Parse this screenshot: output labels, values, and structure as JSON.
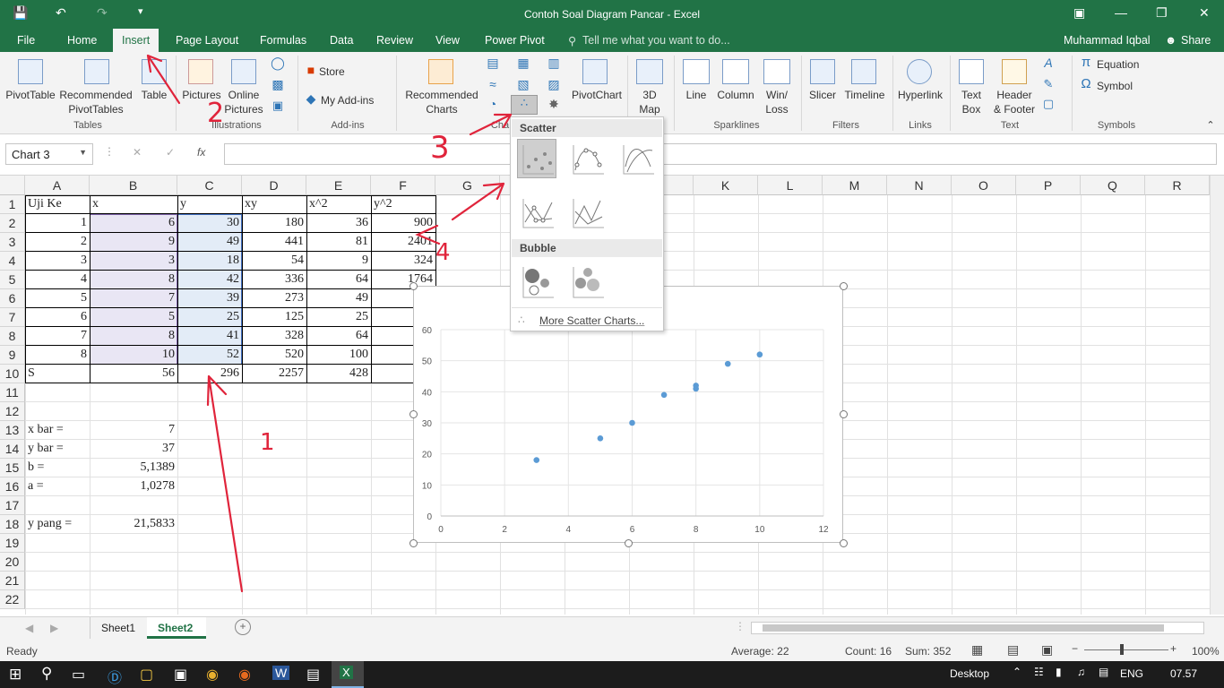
{
  "title_bar": {
    "title": "Contoh Soal Diagram Pancar - Excel"
  },
  "tabs": [
    "File",
    "Home",
    "Insert",
    "Page Layout",
    "Formulas",
    "Data",
    "Review",
    "View",
    "Power Pivot"
  ],
  "active_tab": "Insert",
  "tell_me": "Tell me what you want to do...",
  "user": "Muhammad Iqbal",
  "share": "Share",
  "ribbon": {
    "pivottable": "PivotTable",
    "recommended_pivottables_1": "Recommended",
    "recommended_pivottables_2": "PivotTables",
    "table": "Table",
    "pictures": "Pictures",
    "online_pictures_1": "Online",
    "online_pictures_2": "Pictures",
    "store": "Store",
    "my_addins": "My Add-ins",
    "recommended_charts_1": "Recommended",
    "recommended_charts_2": "Charts",
    "pivotchart": "PivotChart",
    "map_1": "3D",
    "map_2": "Map",
    "line": "Line",
    "column": "Column",
    "winloss_1": "Win/",
    "winloss_2": "Loss",
    "slicer": "Slicer",
    "timeline": "Timeline",
    "hyperlink": "Hyperlink",
    "textbox_1": "Text",
    "textbox_2": "Box",
    "header_1": "Header",
    "header_2": "& Footer",
    "equation": "Equation",
    "symbol": "Symbol",
    "groups": {
      "tables": "Tables",
      "illustrations": "Illustrations",
      "addins": "Add-ins",
      "charts": "Cha",
      "sparklines": "Sparklines",
      "filters": "Filters",
      "links": "Links",
      "text": "Text",
      "symbols": "Symbols"
    }
  },
  "formula_bar": {
    "name_box": "Chart 3",
    "fx": "fx",
    "formula": ""
  },
  "columns": [
    "A",
    "B",
    "C",
    "D",
    "E",
    "F",
    "G",
    "H",
    "I",
    "J",
    "K",
    "L",
    "M",
    "N",
    "O",
    "P",
    "Q",
    "R"
  ],
  "rows": [
    "1",
    "2",
    "3",
    "4",
    "5",
    "6",
    "7",
    "8",
    "9",
    "10",
    "11",
    "12",
    "13",
    "14",
    "15",
    "16",
    "17",
    "18",
    "19",
    "20",
    "21",
    "22"
  ],
  "cells": {
    "header": [
      "Uji Ke",
      "x",
      "y",
      "xy",
      "x^2",
      "y^2"
    ],
    "data": [
      [
        "1",
        "6",
        "30",
        "180",
        "36",
        "900"
      ],
      [
        "2",
        "9",
        "49",
        "441",
        "81",
        "2401"
      ],
      [
        "3",
        "3",
        "18",
        "54",
        "9",
        "324"
      ],
      [
        "4",
        "8",
        "42",
        "336",
        "64",
        "1764"
      ],
      [
        "5",
        "7",
        "39",
        "273",
        "49",
        "1"
      ],
      [
        "6",
        "5",
        "25",
        "125",
        "25",
        ""
      ],
      [
        "7",
        "8",
        "41",
        "328",
        "64",
        "1"
      ],
      [
        "8",
        "10",
        "52",
        "520",
        "100",
        "2"
      ]
    ],
    "sum_row": [
      "S",
      "56",
      "296",
      "2257",
      "428",
      "11"
    ],
    "calc": [
      {
        "label": "x bar =",
        "value": "7"
      },
      {
        "label": "y bar =",
        "value": "37"
      },
      {
        "label": "b =",
        "value": "5,1389"
      },
      {
        "label": "a =",
        "value": "1,0278"
      },
      {
        "label": "y pang =",
        "value": "21,5833"
      }
    ]
  },
  "dropdown": {
    "scatter": "Scatter",
    "bubble": "Bubble",
    "more": "More Scatter Charts..."
  },
  "chart_data": {
    "type": "scatter",
    "x": [
      6,
      9,
      3,
      8,
      7,
      5,
      8,
      10
    ],
    "y": [
      30,
      49,
      18,
      42,
      39,
      25,
      41,
      52
    ],
    "xlim": [
      0,
      12
    ],
    "ylim": [
      0,
      60
    ],
    "xticks": [
      "0",
      "2",
      "4",
      "6",
      "8",
      "10",
      "12"
    ],
    "yticks": [
      "0",
      "10",
      "20",
      "30",
      "40",
      "50",
      "60"
    ],
    "color": "#5b9bd5",
    "grid": true
  },
  "annotations": [
    "1",
    "2",
    "3",
    "4"
  ],
  "sheets": [
    "Sheet1",
    "Sheet2"
  ],
  "active_sheet": "Sheet2",
  "status": {
    "ready": "Ready",
    "average": "Average: 22",
    "count": "Count: 16",
    "sum": "Sum: 352",
    "zoom": "100%"
  },
  "taskbar": {
    "desktop": "Desktop",
    "lang": "ENG",
    "time": "07.57"
  },
  "colors": {
    "excel_green": "#217346",
    "selection": "#e9e6f4",
    "selection2": "#e3ecf7"
  }
}
